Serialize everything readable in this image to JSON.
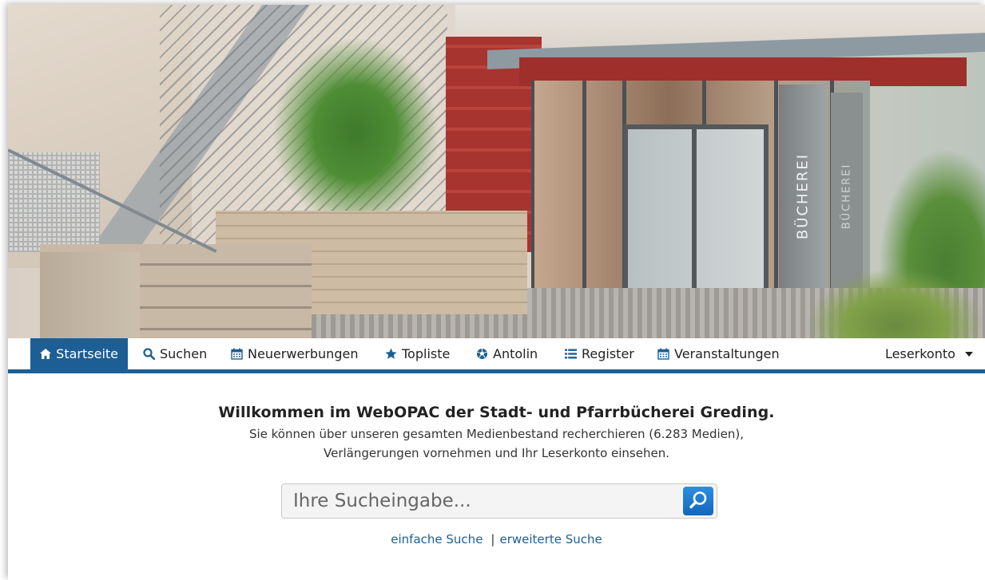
{
  "hero": {
    "sign_text": "BÜCHEREI"
  },
  "nav": {
    "items": [
      {
        "label": "Startseite",
        "icon": "home-icon",
        "active": true
      },
      {
        "label": "Suchen",
        "icon": "search-icon"
      },
      {
        "label": "Neuerwerbungen",
        "icon": "calendar-icon"
      },
      {
        "label": "Topliste",
        "icon": "star-icon"
      },
      {
        "label": "Antolin",
        "icon": "soccer-ball-icon"
      },
      {
        "label": "Register",
        "icon": "list-icon"
      },
      {
        "label": "Veranstaltungen",
        "icon": "calendar-icon"
      }
    ],
    "account": {
      "label": "Leserkonto",
      "icon": "caret-down-icon"
    }
  },
  "welcome": {
    "title": "Willkommen im WebOPAC der Stadt- und Pfarrbücherei Greding.",
    "line1": "Sie können über unseren gesamten Medienbestand recherchieren (6.283 Medien),",
    "line2": "Verlängerungen vornehmen und Ihr Leserkonto einsehen."
  },
  "search": {
    "placeholder": "Ihre Sucheingabe...",
    "value": ""
  },
  "links": {
    "simple": "einfache Suche",
    "separator": "|",
    "advanced": "erweiterte Suche"
  },
  "colors": {
    "accent": "#1d5f95",
    "search_button": "#1e78cc"
  }
}
